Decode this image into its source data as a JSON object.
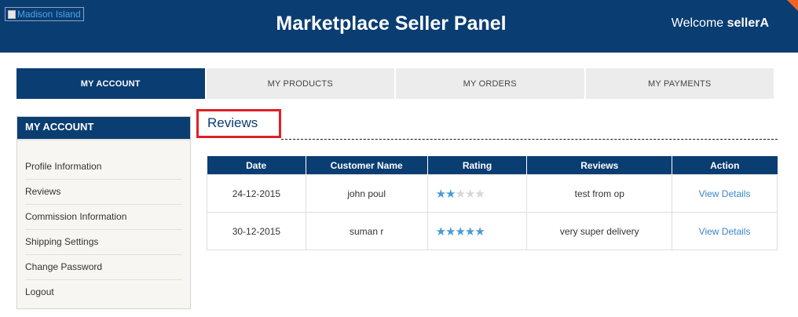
{
  "header": {
    "logo_alt": "Madison Island",
    "title": "Marketplace Seller Panel",
    "welcome_prefix": "Welcome ",
    "username": "sellerA",
    "bg_color": "#0a3d72",
    "corner_color": "#f26322"
  },
  "tabs": [
    {
      "label": "MY ACCOUNT",
      "active": true
    },
    {
      "label": "MY PRODUCTS",
      "active": false
    },
    {
      "label": "MY ORDERS",
      "active": false
    },
    {
      "label": "MY PAYMENTS",
      "active": false
    }
  ],
  "sidebar": {
    "heading": "MY ACCOUNT",
    "items": [
      {
        "label": "Profile Information"
      },
      {
        "label": "Reviews"
      },
      {
        "label": "Commission Information"
      },
      {
        "label": "Shipping Settings"
      },
      {
        "label": "Change Password"
      },
      {
        "label": "Logout"
      }
    ]
  },
  "main": {
    "heading": "Reviews",
    "table": {
      "columns": [
        "Date",
        "Customer Name",
        "Rating",
        "Reviews",
        "Action"
      ],
      "rows": [
        {
          "date": "24-12-2015",
          "customer": "john poul",
          "rating": 2,
          "max_rating": 5,
          "review": "test from op",
          "action": "View Details"
        },
        {
          "date": "30-12-2015",
          "customer": "suman r",
          "rating": 5,
          "max_rating": 5,
          "review": "very super delivery",
          "action": "View Details"
        }
      ]
    }
  },
  "colors": {
    "star_on": "#4a9ad6",
    "star_off": "#d6d6d6",
    "link": "#3b87c9",
    "highlight_border": "#e02027"
  }
}
